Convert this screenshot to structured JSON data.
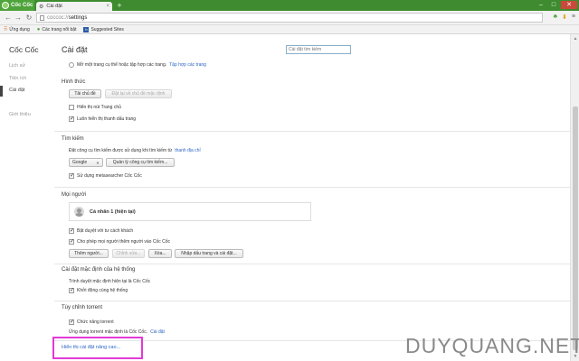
{
  "browser": {
    "brand": "Cốc Cốc",
    "tab_title": "Cài đặt",
    "tab_close": "×",
    "new_tab": "+",
    "url_scheme": "coccoc://",
    "url_path": "settings",
    "icons": [
      "back-icon",
      "forward-icon",
      "reload-icon",
      "leaf-icon",
      "download-icon",
      "menu-icon"
    ],
    "bookmarks": [
      {
        "label": "Ứng dụng",
        "icon": "apps-icon"
      },
      {
        "label": "Các trang nổi bật",
        "icon": "coccoc-icon"
      },
      {
        "label": "Suggested Sites",
        "icon": "bing-icon"
      }
    ]
  },
  "sidebar": {
    "title": "Cốc Cốc",
    "items": [
      "Lịch sử",
      "Tiện ích",
      "Cài đặt",
      "Giới thiệu"
    ]
  },
  "settings": {
    "title": "Cài đặt",
    "search_placeholder": "Cài đặt tìm kiếm",
    "startup_option": "Mở một trang cụ thể hoặc tập hợp các trang.",
    "startup_link": "Tập hợp các trang",
    "appearance": {
      "title": "Hình thức",
      "themes_button": "Tải chủ đề",
      "reset_theme_button": "Đặt lại về chủ đề mặc định",
      "home_button": "Hiển thị nút Trang chủ",
      "bookmarks_bar": "Luôn hiển thị thanh dấu trang"
    },
    "search": {
      "title": "Tìm kiếm",
      "description": "Đặt công cụ tìm kiếm được sử dụng khi tìm kiếm từ",
      "description_link": "thanh địa chỉ",
      "engine": "Google",
      "manage_button": "Quản lý công cụ tìm kiếm...",
      "metasearcher": "Sử dụng metasearcher Cốc Cốc"
    },
    "people": {
      "title": "Mọi người",
      "profile_name": "Cá nhân 1 (hiện tại)",
      "guest_browsing": "Bật duyệt với tư cách khách",
      "let_anyone_add": "Cho phép mọi người thêm người vào Cốc Cốc",
      "add_button": "Thêm người...",
      "edit_button": "Chỉnh sửa...",
      "remove_button": "Xóa...",
      "import_button": "Nhập dấu trang và cài đặt..."
    },
    "default_browser": {
      "title": "Cài đặt mặc định của hệ thống",
      "status": "Trình duyệt mặc định hiện tại là Cốc Cốc",
      "start_with_system": "Khởi động cùng hệ thống"
    },
    "torrent": {
      "title": "Tùy chỉnh torrent",
      "feature": "Chức năng torrent",
      "default_app": "Ứng dụng torrent mặc định là Cốc Cốc.",
      "default_app_link": "Cài đặt"
    },
    "advanced_link": "Hiển thị cài đặt nâng cao..."
  },
  "watermark": "DUYQUANG.NET",
  "colors": {
    "tabstrip": "#3e8c2f",
    "link": "#2c64c4",
    "highlight": "#e23ad6"
  }
}
